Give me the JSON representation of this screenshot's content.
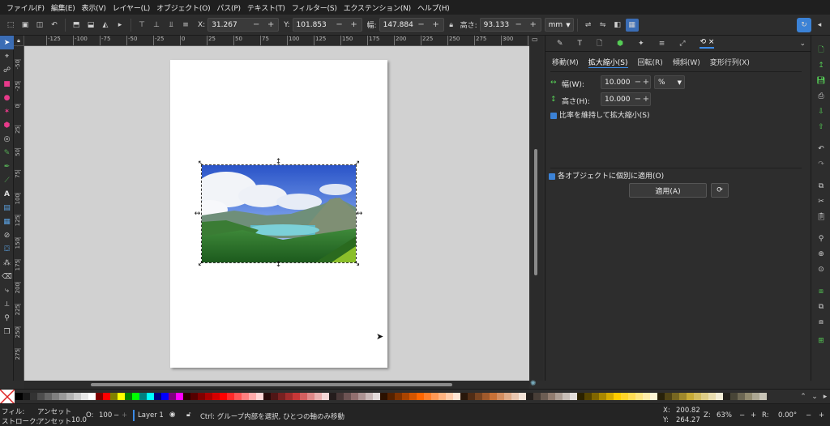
{
  "menu": [
    "ファイル(F)",
    "編集(E)",
    "表示(V)",
    "レイヤー(L)",
    "オブジェクト(O)",
    "パス(P)",
    "テキスト(T)",
    "フィルター(S)",
    "エクステンション(N)",
    "ヘルプ(H)"
  ],
  "toolbar": {
    "x_label": "X:",
    "x_value": "31.267",
    "y_label": "Y:",
    "y_value": "101.853",
    "w_label": "幅:",
    "w_value": "147.884",
    "h_label": "高さ:",
    "h_value": "93.133",
    "unit": "mm"
  },
  "ruler_top": [
    "-125",
    "-100",
    "-75",
    "-50",
    "-25",
    "0",
    "25",
    "50",
    "75",
    "100",
    "125",
    "150",
    "175",
    "200",
    "225",
    "250",
    "275",
    "300",
    "325"
  ],
  "ruler_left": [
    "-75",
    "-50",
    "-25",
    "0",
    "25",
    "50",
    "75",
    "100",
    "125",
    "150",
    "175",
    "200",
    "225",
    "250",
    "275"
  ],
  "dock": {
    "subtabs": [
      "移動(M)",
      "拡大縮小(S)",
      "回転(R)",
      "傾斜(W)",
      "変形行列(X)"
    ],
    "width_label": "幅(W):",
    "width_value": "10.000",
    "height_label": "高さ(H):",
    "height_value": "10.000",
    "unit": "%",
    "keep_ratio_label": "比率を維持して拡大縮小(S)",
    "each_object_label": "各オブジェクトに個別に適用(O)",
    "apply_label": "適用(A)"
  },
  "status": {
    "fill_label": "フィル:",
    "fill_value": "アンセット",
    "stroke_label": "ストローク:",
    "stroke_value": "アンセット",
    "stroke_width": "10.0",
    "opacity_label": "O:",
    "opacity_value": "100",
    "layer": "Layer 1",
    "message": "Ctrl: グループ内部を選択, ひとつの軸のみ移動",
    "x_label": "X:",
    "x_value": "200.82",
    "y_label": "Y:",
    "y_value": "264.27",
    "zoom_label": "Z:",
    "zoom_value": "63%",
    "rot_label": "R:",
    "rot_value": "0.00°"
  },
  "colors": {
    "accent": "#3b8be8"
  },
  "palette": [
    "#000000",
    "#1a1a1a",
    "#333333",
    "#4d4d4d",
    "#666666",
    "#808080",
    "#999999",
    "#b3b3b3",
    "#cccccc",
    "#e6e6e6",
    "#ffffff",
    "#800000",
    "#ff0000",
    "#808000",
    "#ffff00",
    "#008000",
    "#00ff00",
    "#008080",
    "#00ffff",
    "#000080",
    "#0000ff",
    "#800080",
    "#ff00ff",
    "#2b0000",
    "#550000",
    "#800000",
    "#aa0000",
    "#d40000",
    "#ff0000",
    "#ff2a2a",
    "#ff5555",
    "#ff8080",
    "#ffaaaa",
    "#ffd5d5",
    "#280b0b",
    "#501616",
    "#782121",
    "#a02c2c",
    "#c83737",
    "#d35f5f",
    "#de8787",
    "#e9afaf",
    "#f4d7d7",
    "#241c1c",
    "#483737",
    "#6c5353",
    "#916f6f",
    "#ac9393",
    "#c8b7b7",
    "#e3dbdb",
    "#2b1100",
    "#552200",
    "#803300",
    "#aa4400",
    "#d45500",
    "#ff6600",
    "#ff7f2a",
    "#ff9955",
    "#ffb380",
    "#ffccaa",
    "#ffe6d5",
    "#28170b",
    "#502d16",
    "#784421",
    "#a05a2c",
    "#c87137",
    "#d38d5f",
    "#deaa87",
    "#e9c6af",
    "#f4e3d7",
    "#241f1c",
    "#483e37",
    "#6c5d53",
    "#917c6f",
    "#ac9d93",
    "#c8beb7",
    "#e3dedb",
    "#2b2200",
    "#554400",
    "#806600",
    "#aa8800",
    "#d4aa00",
    "#ffcc00",
    "#ffd42a",
    "#ffdd55",
    "#ffe680",
    "#ffeeaa",
    "#fff6d5",
    "#28220b",
    "#504416",
    "#786721",
    "#a0892c",
    "#c8ab37",
    "#d3bc5f",
    "#decd87",
    "#e9ddaf",
    "#f4eed7",
    "#24221c",
    "#484537",
    "#6c6753",
    "#918a6f",
    "#aca793",
    "#c8c4b7"
  ]
}
